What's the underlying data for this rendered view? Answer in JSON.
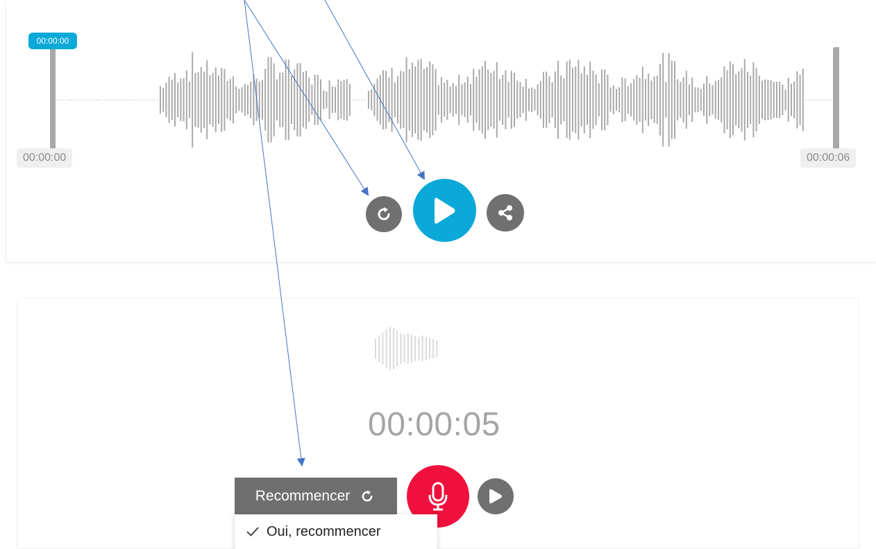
{
  "player": {
    "playhead_time": "00:00:00",
    "start_time": "00:00:00",
    "end_time": "00:00:06",
    "accent_color": "#0ba9d8",
    "controls": {
      "restart_icon": "restart-icon",
      "play_icon": "play-icon",
      "share_icon": "share-icon"
    }
  },
  "recorder": {
    "timer": "00:00:05",
    "reset_label": "Recommencer",
    "reset_icon": "restart-icon",
    "mic_icon": "microphone-icon",
    "mic_color": "#f0103d",
    "play_icon": "play-icon",
    "confirm_menu": {
      "check_icon": "checkmark-icon",
      "option_label": "Oui, recommencer"
    }
  }
}
